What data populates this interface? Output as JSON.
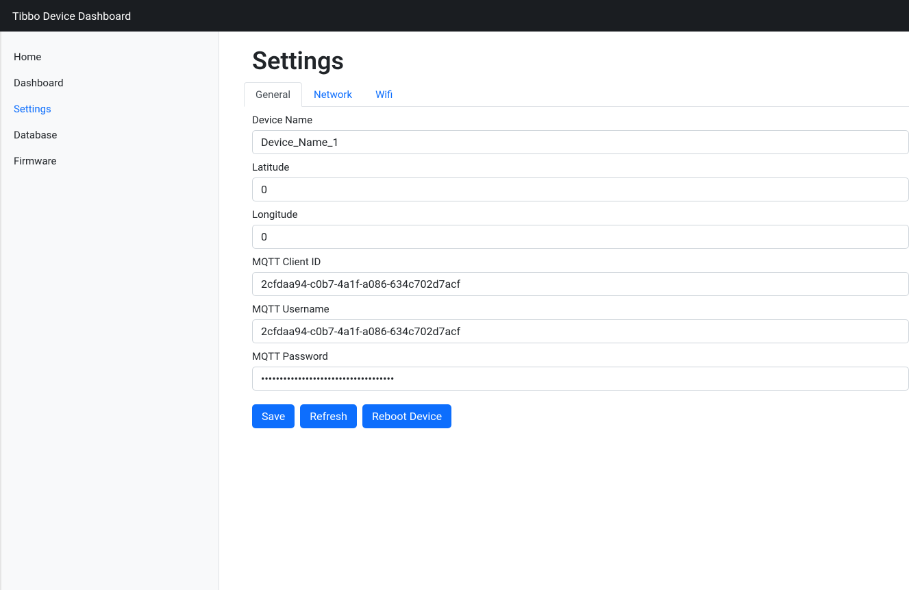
{
  "header": {
    "title": "Tibbo Device Dashboard"
  },
  "sidebar": {
    "items": [
      {
        "label": "Home",
        "active": false
      },
      {
        "label": "Dashboard",
        "active": false
      },
      {
        "label": "Settings",
        "active": true
      },
      {
        "label": "Database",
        "active": false
      },
      {
        "label": "Firmware",
        "active": false
      }
    ]
  },
  "page": {
    "title": "Settings"
  },
  "tabs": [
    {
      "label": "General",
      "active": true
    },
    {
      "label": "Network",
      "active": false
    },
    {
      "label": "Wifi",
      "active": false
    }
  ],
  "form": {
    "device_name": {
      "label": "Device Name",
      "value": "Device_Name_1"
    },
    "latitude": {
      "label": "Latitude",
      "value": "0"
    },
    "longitude": {
      "label": "Longitude",
      "value": "0"
    },
    "mqtt_client_id": {
      "label": "MQTT Client ID",
      "value": "2cfdaa94-c0b7-4a1f-a086-634c702d7acf"
    },
    "mqtt_username": {
      "label": "MQTT Username",
      "value": "2cfdaa94-c0b7-4a1f-a086-634c702d7acf"
    },
    "mqtt_password": {
      "label": "MQTT Password",
      "value": "••••••••••••••••••••••••••••••••••••"
    }
  },
  "buttons": {
    "save": "Save",
    "refresh": "Refresh",
    "reboot": "Reboot Device"
  }
}
